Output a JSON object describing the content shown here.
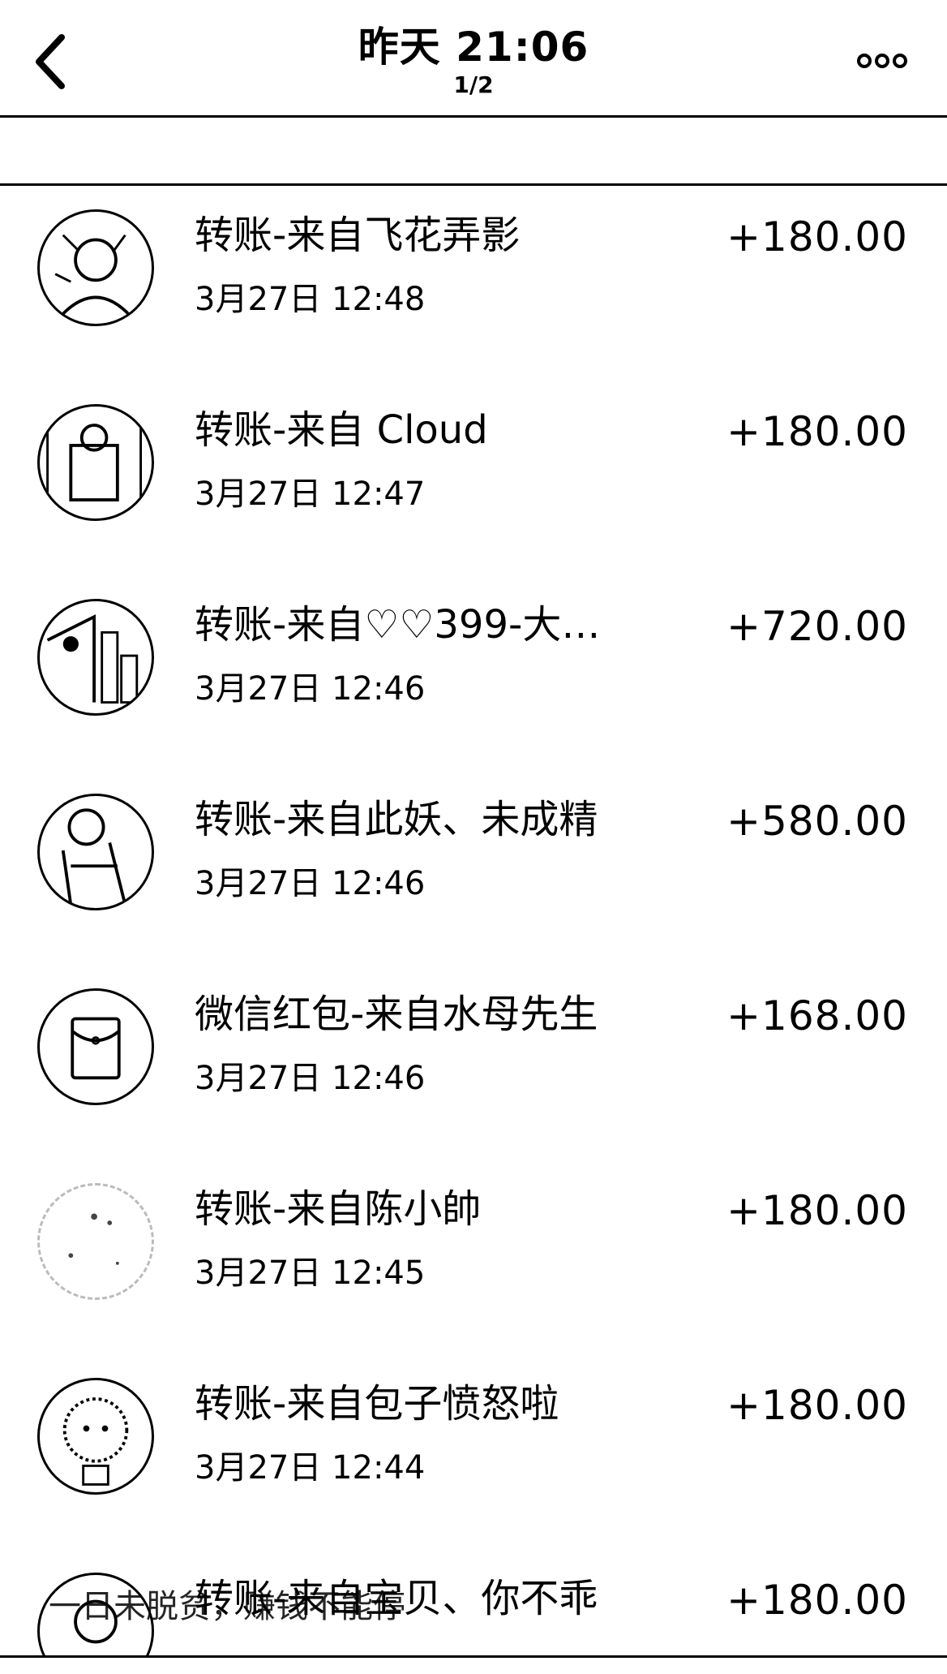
{
  "header": {
    "back_icon": "chevron-left-icon",
    "title": "昨天 21:06",
    "subtitle": "1/2",
    "more_icon": "more-dots-icon"
  },
  "transactions": [
    {
      "title": "转账-来自飞花弄影",
      "time": "3月27日 12:48",
      "amount": "+180.00",
      "avatar": "photo"
    },
    {
      "title": "转账-来自 Cloud",
      "time": "3月27日 12:47",
      "amount": "+180.00",
      "avatar": "photo"
    },
    {
      "title": "转账-来自♡♡399-大…",
      "time": "3月27日 12:46",
      "amount": "+720.00",
      "avatar": "photo"
    },
    {
      "title": "转账-来自此妖、未成精",
      "time": "3月27日 12:46",
      "amount": "+580.00",
      "avatar": "photo"
    },
    {
      "title": "微信红包-来自水母先生",
      "time": "3月27日 12:46",
      "amount": "+168.00",
      "avatar": "red-packet-icon"
    },
    {
      "title": "转账-来自陈小帥",
      "time": "3月27日 12:45",
      "amount": "+180.00",
      "avatar": "photo-faded"
    },
    {
      "title": "转账-来自包子愤怒啦",
      "time": "3月27日 12:44",
      "amount": "+180.00",
      "avatar": "photo"
    },
    {
      "title": "转账-来自宝贝、你不乖",
      "time": "",
      "amount": "+180.00",
      "avatar": "photo"
    }
  ],
  "overlay": {
    "text": "一日未脱贫，赚钱不能停"
  }
}
